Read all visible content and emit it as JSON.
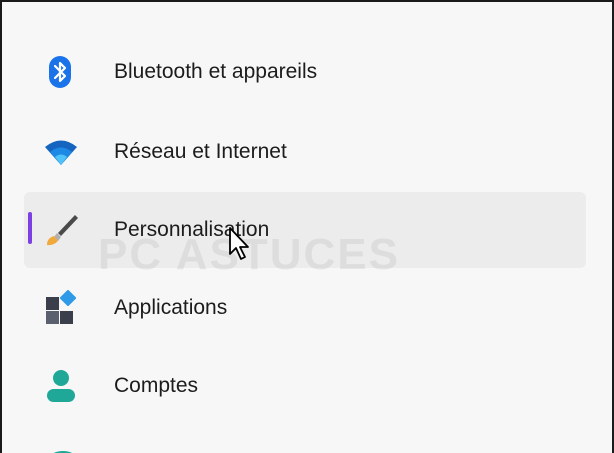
{
  "sidebar": {
    "items": [
      {
        "label": "Bluetooth et appareils",
        "icon": "bluetooth-icon",
        "selected": false
      },
      {
        "label": "Réseau et Internet",
        "icon": "wifi-icon",
        "selected": false
      },
      {
        "label": "Personnalisation",
        "icon": "paintbrush-icon",
        "selected": true
      },
      {
        "label": "Applications",
        "icon": "apps-icon",
        "selected": false
      },
      {
        "label": "Comptes",
        "icon": "person-icon",
        "selected": false
      }
    ]
  },
  "watermark": {
    "text": "PC ASTUCES"
  },
  "colors": {
    "accent": "#7b3fe4",
    "bluetooth": "#1a73e8",
    "wifi": "#1565c0",
    "person": "#1fa898",
    "selected_bg": "#ececec"
  }
}
